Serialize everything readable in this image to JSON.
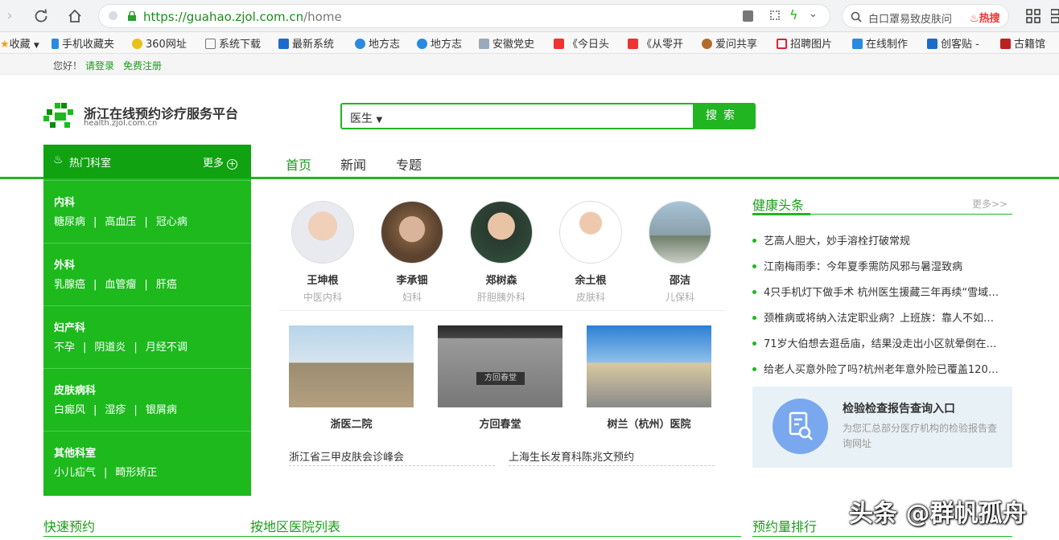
{
  "browser": {
    "url_host": "https://guahao.zjol.com.cn",
    "url_path": "/home",
    "search_text": "白口罩易致皮肤问",
    "hot_label": "热搜"
  },
  "bookmarks": [
    "收藏",
    "手机收藏夹",
    "360网址",
    "系统下载",
    "最新系统",
    "地方志",
    "地方志",
    "安徽党史",
    "《今日头",
    "《从零开",
    "爱问共享",
    "招聘图片",
    "在线制作",
    "创客贴 -",
    "古籍馆"
  ],
  "topbar": {
    "greeting": "您好！",
    "login": "请登录",
    "register": "免费注册"
  },
  "header": {
    "logo_title": "浙江在线预约诊疗服务平台",
    "logo_url": "health.zjol.com.cn",
    "search_select": "医生",
    "search_button": "搜索"
  },
  "nav": [
    "首页",
    "新闻",
    "专题"
  ],
  "sidebar": {
    "title": "热门科室",
    "more": "更多",
    "sections": [
      {
        "title": "内科",
        "links": [
          "糖尿病",
          "高血压",
          "冠心病"
        ]
      },
      {
        "title": "外科",
        "links": [
          "乳腺癌",
          "血管瘤",
          "肝癌"
        ]
      },
      {
        "title": "妇产科",
        "links": [
          "不孕",
          "阴道炎",
          "月经不调"
        ]
      },
      {
        "title": "皮肤病科",
        "links": [
          "白癜风",
          "湿疹",
          "银屑病"
        ]
      },
      {
        "title": "其他科室",
        "links": [
          "小儿疝气",
          "畸形矫正"
        ]
      }
    ]
  },
  "doctors": [
    {
      "name": "王坤根",
      "dept": "中医内科"
    },
    {
      "name": "李承钿",
      "dept": "妇科"
    },
    {
      "name": "郑树森",
      "dept": "肝胆胰外科"
    },
    {
      "name": "余土根",
      "dept": "皮肤科"
    },
    {
      "name": "邵洁",
      "dept": "儿保科"
    }
  ],
  "hospitals": [
    {
      "name": "浙医二院"
    },
    {
      "name": "方回春堂"
    },
    {
      "name": "树兰（杭州）医院"
    }
  ],
  "hospital_sign": "方回春堂",
  "news_links": [
    "浙江省三甲皮肤会诊峰会",
    "上海生长发育科陈兆文预约"
  ],
  "health_news": {
    "title": "健康头条",
    "more": "更多>>",
    "items": [
      "艺高人胆大，妙手溶栓打破常规",
      "江南梅雨季：今年夏季需防风邪与暑湿致病",
      "4只手机灯下做手术 杭州医生援藏三年再续“雪域…",
      "颈椎病或将纳入法定职业病？上班族：靠人不如…",
      "71岁大伯想去逛岳庙，结果没走出小区就晕倒在…",
      "给老人买意外险了吗?杭州老年意外险已覆盖120…"
    ]
  },
  "report": {
    "title": "检验检查报告查询入口",
    "desc": "为您汇总部分医疗机构的检验报告查询网址"
  },
  "bottom": {
    "quick": "快速预约",
    "by_region": "按地区医院列表",
    "ranking": "预约量排行"
  },
  "watermark": "头条 @群帆孤舟",
  "colors": {
    "brand_green": "#1db91d",
    "text": "#333333",
    "muted": "#aaaaaa"
  }
}
